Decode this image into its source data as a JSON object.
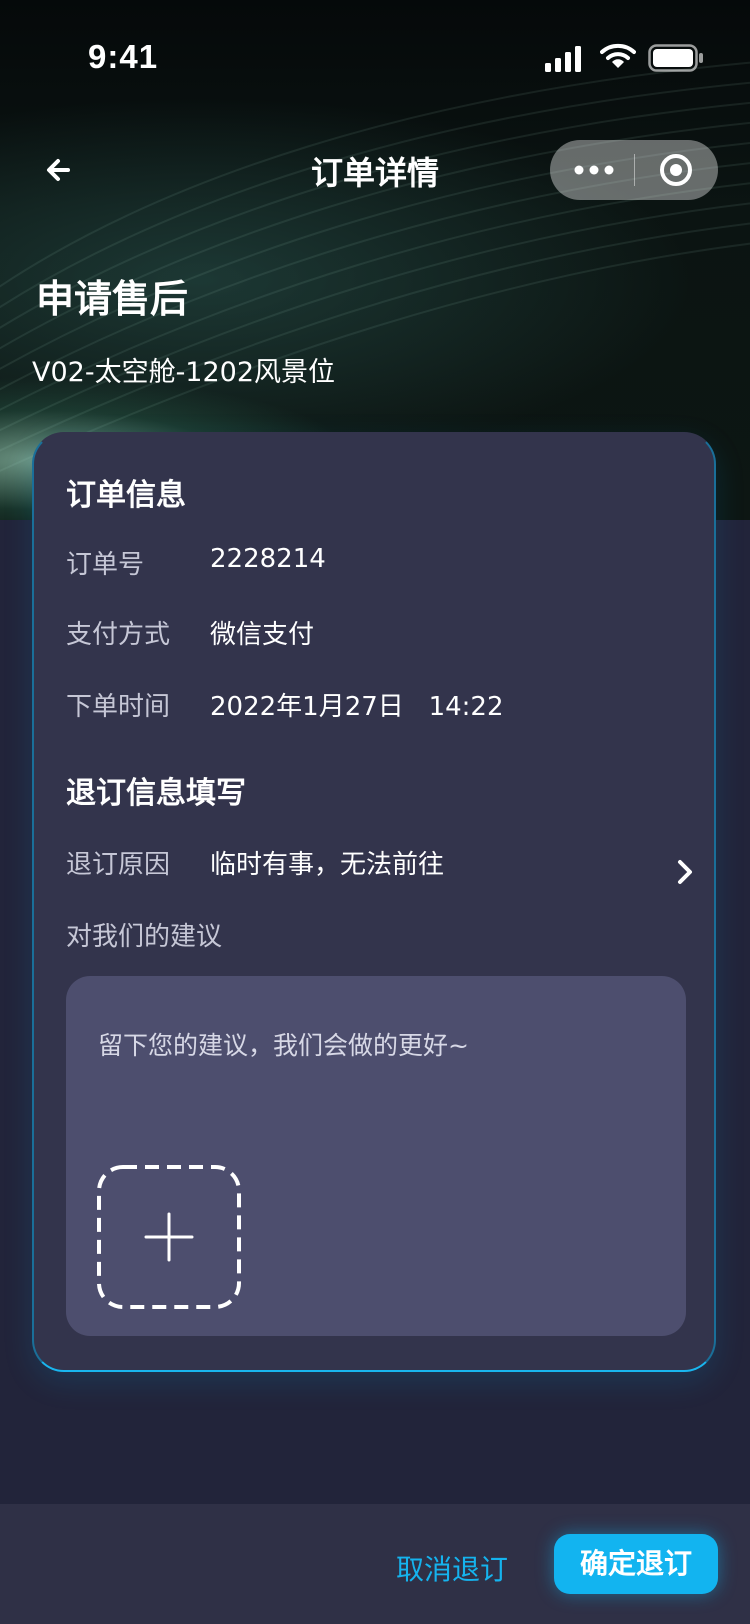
{
  "status_bar": {
    "time": "9:41"
  },
  "nav": {
    "title": "订单详情"
  },
  "header": {
    "title": "申请售后",
    "subtitle": "V02-太空舱-1202风景位"
  },
  "order_info": {
    "title": "订单信息",
    "rows": [
      {
        "label": "订单号",
        "value": "2228214"
      },
      {
        "label": "支付方式",
        "value": "微信支付"
      },
      {
        "label": "下单时间",
        "value": "2022年1月27日   14:22"
      }
    ]
  },
  "refund_info": {
    "title": "退订信息填写",
    "reason_label": "退订原因",
    "reason_value": "临时有事，无法前往",
    "suggestion_label": "对我们的建议",
    "suggestion_placeholder": "留下您的建议，我们会做的更好~"
  },
  "footer": {
    "cancel_label": "取消退订",
    "confirm_label": "确定退订"
  },
  "colors": {
    "accent": "#12b4f0",
    "card_bg": "#33344c",
    "textarea_bg": "#4d4e6e",
    "page_bg": "#22243a"
  },
  "icons": [
    "back-arrow-icon",
    "more-dots-icon",
    "close-target-icon",
    "chevron-right-icon",
    "plus-icon",
    "signal-icon",
    "wifi-icon",
    "battery-icon"
  ]
}
